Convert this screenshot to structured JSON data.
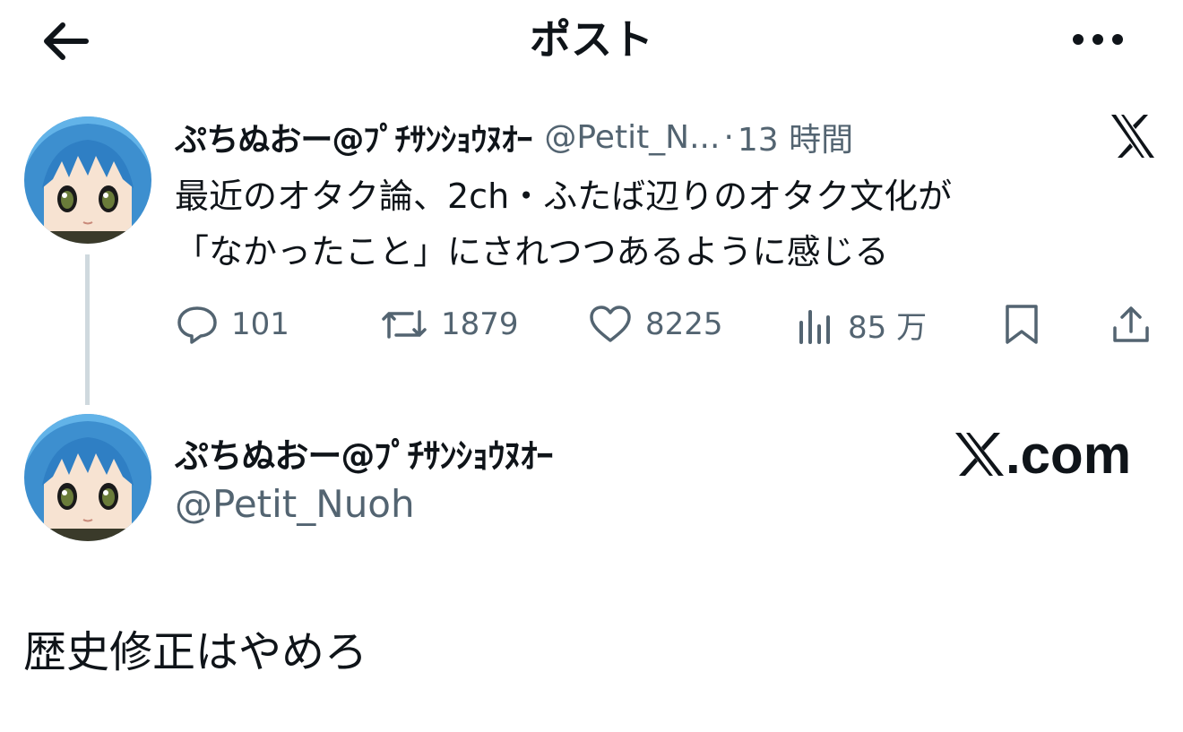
{
  "header": {
    "title": "ポスト",
    "back_icon": "arrow-left-icon",
    "more_icon": "more-horizontal-icon"
  },
  "tweet": {
    "display_name": "ぷちぬおー@ﾌﾟﾁｻﾝｼｮｳﾇｵｰ",
    "handle": "@Petit_N...",
    "separator": "·",
    "time": "13 時間",
    "text_line1": "最近のオタク論、2ch・ふたば辺りのオタク文化が",
    "text_line2": "「なかったこと」にされつつあるように感じる",
    "source_icon": "x-logo-icon",
    "actions": {
      "replies": "101",
      "reposts": "1879",
      "likes": "8225",
      "views": "85 万"
    }
  },
  "card": {
    "display_name": "ぷちぬおー@ﾌﾟﾁｻﾝｼｮｳﾇｵｰ",
    "handle": "@Petit_Nuoh",
    "brand": ".com"
  },
  "body_text": "歴史修正はやめろ",
  "colors": {
    "text": "#0f1419",
    "secondary": "#536471",
    "thread_line": "#cfd9de",
    "background": "#ffffff"
  }
}
